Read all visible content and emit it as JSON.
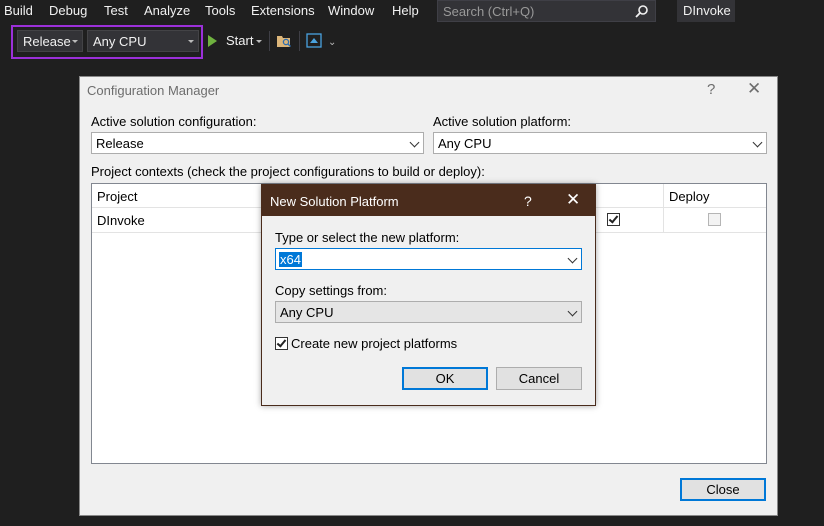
{
  "menu": [
    "Build",
    "Debug",
    "Test",
    "Analyze",
    "Tools",
    "Extensions",
    "Window",
    "Help"
  ],
  "search": {
    "placeholder": "Search (Ctrl+Q)",
    "icon": "search-icon"
  },
  "solution_name": "DInvoke",
  "toolbar": {
    "configuration": "Release",
    "platform": "Any CPU",
    "start_label": "Start"
  },
  "config_manager": {
    "title": "Configuration Manager",
    "help": "?",
    "close": "✕",
    "active_config_label": "Active solution configuration:",
    "active_config_value": "Release",
    "active_platform_label": "Active solution platform:",
    "active_platform_value": "Any CPU",
    "contexts_label": "Project contexts (check the project configurations to build or deploy):",
    "columns": [
      "Project",
      "Deploy"
    ],
    "rows": [
      {
        "project": "DInvoke",
        "build": true,
        "deploy": false
      }
    ],
    "close_button": "Close"
  },
  "new_platform": {
    "title": "New Solution Platform",
    "help": "?",
    "close": "✕",
    "type_label": "Type or select the new platform:",
    "platform_value": "x64",
    "copy_label": "Copy settings from:",
    "copy_value": "Any CPU",
    "create_checkbox_label": "Create new project platforms",
    "create_checked": true,
    "ok": "OK",
    "cancel": "Cancel"
  },
  "colors": {
    "accent": "#0078d7",
    "highlight_border": "#9b30d9",
    "dialog_title_bar": "#4a2c1c"
  }
}
